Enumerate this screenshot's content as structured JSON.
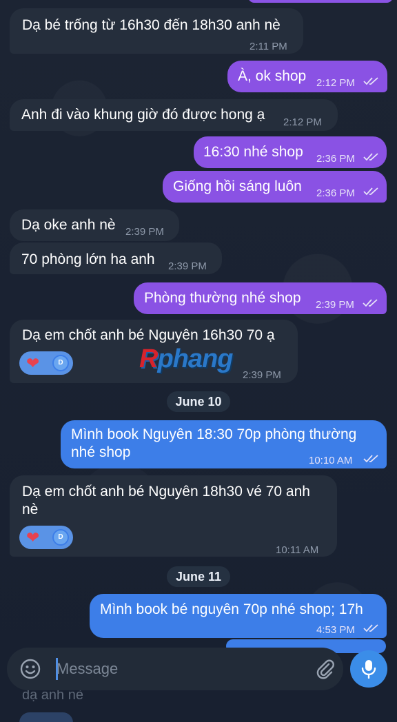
{
  "messages": [
    {
      "text": "Dạ bé trống từ 16h30 đến 18h30 anh nè",
      "time": "2:11 PM"
    },
    {
      "text": "À, ok shop",
      "time": "2:12 PM"
    },
    {
      "text": "Anh đi vào khung giờ đó được hong ạ",
      "time": "2:12 PM"
    },
    {
      "text": "16:30 nhé shop",
      "time": "2:36 PM"
    },
    {
      "text": "Giống hồi sáng luôn",
      "time": "2:36 PM"
    },
    {
      "text": "Dạ oke anh nè",
      "time": "2:39 PM"
    },
    {
      "text": "70 phòng lớn ha anh",
      "time": "2:39 PM"
    },
    {
      "text": "Phòng thường nhé shop",
      "time": "2:39 PM"
    },
    {
      "text": "Dạ em chốt anh bé Nguyên 16h30 70 ạ",
      "time": "2:39 PM",
      "reaction": "❤",
      "reactor": "D"
    },
    {
      "line1": "Mình book Nguyên 18:30 70p phòng thường",
      "line2": "nhé shop",
      "time": "10:10 AM"
    },
    {
      "line1": "Dạ em chốt anh bé Nguyên 18h30 vé 70 anh",
      "line2": "nè",
      "time": "10:11 AM",
      "reaction": "❤",
      "reactor": "D"
    },
    {
      "text": "Mình book bé nguyên 70p nhé shop; 17h",
      "time": "4:53 PM"
    }
  ],
  "dates": {
    "june10": "June 10",
    "june11": "June 11"
  },
  "watermark": {
    "part1": "R",
    "part2": "phang"
  },
  "composer": {
    "placeholder": "Message"
  },
  "below": {
    "text": "dạ anh nè"
  },
  "icons": {
    "read": "double-check-icon",
    "emoji": "smiley-icon",
    "attach": "paperclip-icon",
    "mic": "microphone-icon",
    "reaction": "heart-icon"
  },
  "colors": {
    "incoming": "#252e3c",
    "outgoing_purple": "#8a52e4",
    "outgoing_blue": "#3d7ee8",
    "background": "#1a2231"
  }
}
